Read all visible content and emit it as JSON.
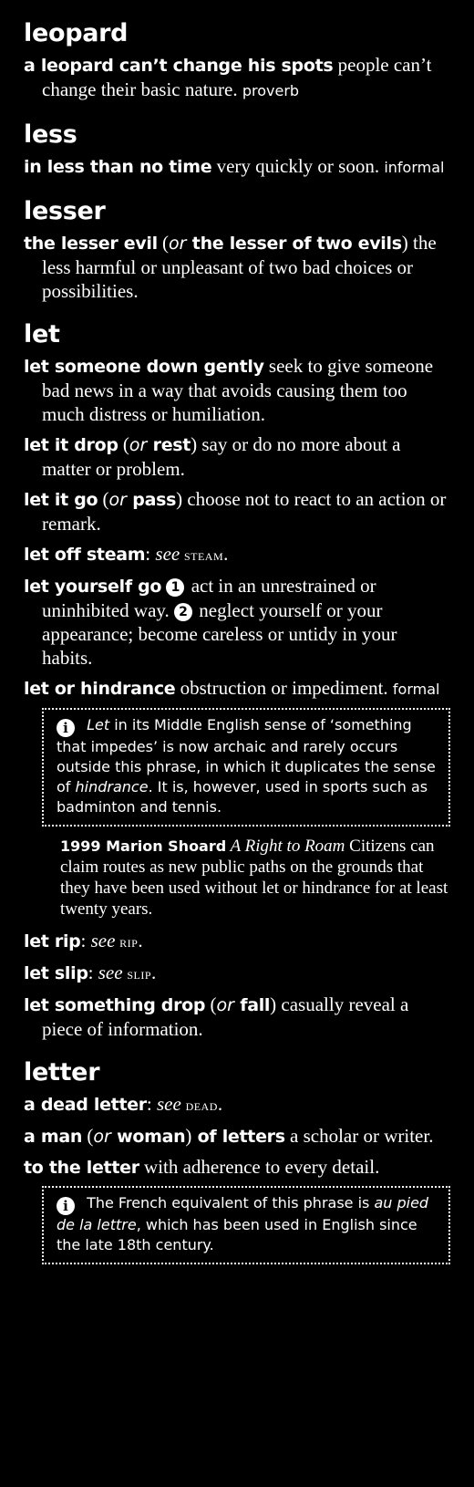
{
  "entries": [
    {
      "headword": "leopard",
      "senses": [
        {
          "phrase": "a leopard can’t change his spots",
          "definition": " people can’t change their basic nature.",
          "label": "proverb"
        }
      ]
    },
    {
      "headword": "less",
      "senses": [
        {
          "phrase": "in less than no time",
          "definition": " very quickly or soon.",
          "label": "informal"
        }
      ]
    },
    {
      "headword": "lesser",
      "senses": [
        {
          "phrase": "the lesser evil",
          "paren_open": " (",
          "or": "or",
          "phrase2": " the lesser of two evils",
          "paren_close": ")",
          "definition": " the less harmful or unpleasant of two bad choices or possibilities."
        }
      ]
    },
    {
      "headword": "let",
      "senses": [
        {
          "phrase": "let someone down gently",
          "definition": " seek to give someone bad news in a way that avoids causing them too much distress or humiliation."
        },
        {
          "phrase": "let it drop",
          "paren_open": " (",
          "or": "or",
          "phrase2": " rest",
          "paren_close": ")",
          "definition": " say or do no more about a matter or problem."
        },
        {
          "phrase": "let it go",
          "paren_open": " (",
          "or": "or",
          "phrase2": " pass",
          "paren_close": ")",
          "definition": " choose not to react to an action or remark."
        },
        {
          "phrase": "let off steam",
          "colon": ": ",
          "see": "see",
          "xref": " steam",
          "end": "."
        },
        {
          "phrase": "let yourself go",
          "num1": "1",
          "def1": " act in an unrestrained or uninhibited way. ",
          "num2": "2",
          "def2": " neglect yourself or your appearance; become careless or untidy in your habits."
        },
        {
          "phrase": "let or hindrance",
          "definition": " obstruction or impediment.",
          "label": "formal"
        }
      ],
      "note": {
        "pre": " ",
        "it1": "Let",
        "text1": " in its Middle English sense of ‘something that impedes’ is now archaic and rarely occurs outside this phrase, in which it duplicates the sense of ",
        "it2": "hindrance",
        "text2": ". It is, however, used in sports such as badminton and tennis."
      },
      "quote": {
        "year": "1999",
        "author": " Marion Shoard",
        "title": " A Right to Roam",
        "text": " Citizens can claim routes as new public paths on the grounds that they have been used without let or hindrance for at least twenty years."
      },
      "senses_after": [
        {
          "phrase": "let rip",
          "colon": ": ",
          "see": "see",
          "xref": " rip",
          "end": "."
        },
        {
          "phrase": "let slip",
          "colon": ": ",
          "see": "see",
          "xref": " slip",
          "end": "."
        },
        {
          "phrase": "let something drop",
          "paren_open": " (",
          "or": "or",
          "phrase2": " fall",
          "paren_close": ")",
          "definition": " casually reveal a piece of information."
        }
      ]
    },
    {
      "headword": "letter",
      "senses": [
        {
          "phrase": "a dead letter",
          "colon": ": ",
          "see": "see",
          "xref": " dead",
          "end": "."
        },
        {
          "phrase": "a man",
          "paren_open": " (",
          "or": "or",
          "phrase2": " woman",
          "paren_close": ")",
          "phrase3": " of letters",
          "definition": " a scholar or writer."
        },
        {
          "phrase": "to the letter",
          "definition": " with adherence to every detail."
        }
      ],
      "note": {
        "text1": " The French equivalent of this phrase is ",
        "it1": "au pied de la lettre",
        "text2": ", which has been used in English since the late 18th century."
      }
    }
  ],
  "icons": {
    "info": "info-icon",
    "numbers": "circled-number"
  }
}
